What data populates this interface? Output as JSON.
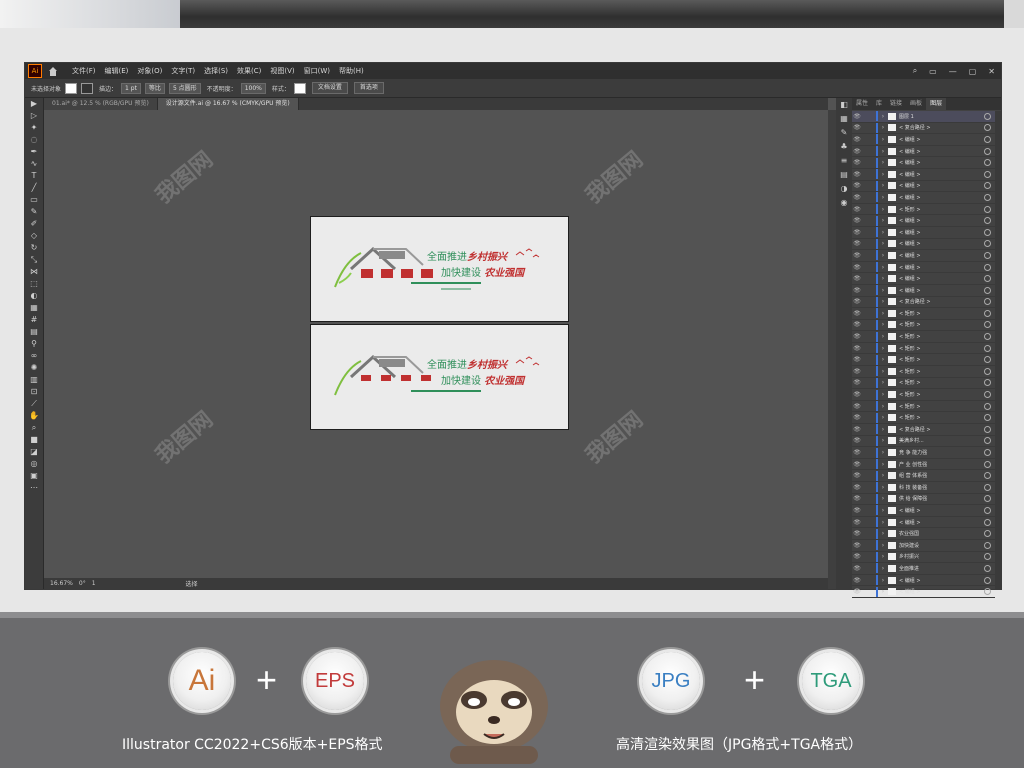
{
  "window": {
    "menu": [
      "文件(F)",
      "编辑(E)",
      "对象(O)",
      "文字(T)",
      "选择(S)",
      "效果(C)",
      "视图(V)",
      "窗口(W)",
      "帮助(H)"
    ],
    "logo": "Ai"
  },
  "control_bar": {
    "no_selection": "未选择对象",
    "stroke_label": "描边：",
    "stroke_value": "1 pt",
    "uniform": "等比",
    "brush": "5 点圆形",
    "opacity_label": "不透明度：",
    "opacity_value": "100%",
    "style_label": "样式：",
    "doc_setup": "文档设置",
    "prefs": "首选项"
  },
  "doc_tabs": [
    {
      "label": "01.ai* @ 12.5 % (RGB/GPU 预览)",
      "active": false
    },
    {
      "label": "设计源文件.ai @ 16.67 % (CMYK/GPU 预览)",
      "active": true
    }
  ],
  "artwork": {
    "line1": "全面推进",
    "line1_accent": "乡村振兴",
    "line2": "加快建设",
    "line2_accent": "农业强国"
  },
  "status": {
    "zoom": "16.67%",
    "angle": "0°",
    "page": "1",
    "tool": "选择"
  },
  "panel": {
    "tabs": [
      "属性",
      "库",
      "链接",
      "画板",
      "图层"
    ],
    "active_tab": "图层",
    "layers": [
      {
        "name": "图层 1",
        "top": true
      },
      {
        "name": "< 复合路径 >"
      },
      {
        "name": "< 编组 >"
      },
      {
        "name": "< 编组 >"
      },
      {
        "name": "< 编组 >"
      },
      {
        "name": "< 编组 >"
      },
      {
        "name": "< 编组 >"
      },
      {
        "name": "< 编组 >"
      },
      {
        "name": "< 矩形 >"
      },
      {
        "name": "< 编组 >"
      },
      {
        "name": "< 编组 >"
      },
      {
        "name": "< 编组 >"
      },
      {
        "name": "< 编组 >"
      },
      {
        "name": "< 编组 >"
      },
      {
        "name": "< 编组 >"
      },
      {
        "name": "< 编组 >"
      },
      {
        "name": "< 复合路径 >"
      },
      {
        "name": "< 矩形 >"
      },
      {
        "name": "< 矩形 >"
      },
      {
        "name": "< 矩形 >"
      },
      {
        "name": "< 矩形 >"
      },
      {
        "name": "< 矩形 >"
      },
      {
        "name": "< 矩形 >"
      },
      {
        "name": "< 矩形 >"
      },
      {
        "name": "< 矩形 >"
      },
      {
        "name": "< 矩形 >"
      },
      {
        "name": "< 矩形 >"
      },
      {
        "name": "< 复合路径 >"
      },
      {
        "name": "美满乡村..."
      },
      {
        "name": "竞 争 能力强"
      },
      {
        "name": "产 业 创性强"
      },
      {
        "name": "组 营 体系强"
      },
      {
        "name": "科 技 装备强"
      },
      {
        "name": "供 给 保障强"
      },
      {
        "name": "< 编组 >"
      },
      {
        "name": "< 编组 >"
      },
      {
        "name": "农业强国"
      },
      {
        "name": "加快建设"
      },
      {
        "name": "乡村振兴"
      },
      {
        "name": "全面推进"
      },
      {
        "name": "< 编组 >"
      },
      {
        "name": "< 编组 >"
      }
    ]
  },
  "formats": {
    "left": [
      "Ai",
      "EPS"
    ],
    "right": [
      "JPG",
      "TGA"
    ],
    "plus": "+",
    "caption_left": "Illustrator CC2022+CS6版本+EPS格式",
    "caption_right": "高清渲染效果图（JPG格式+TGA格式）"
  },
  "colors": {
    "ai": "#c8763a",
    "eps": "#c23b3b",
    "jpg": "#3a7fc2",
    "tga": "#2e9b7a",
    "green": "#2f8f5a",
    "red": "#c03030"
  }
}
